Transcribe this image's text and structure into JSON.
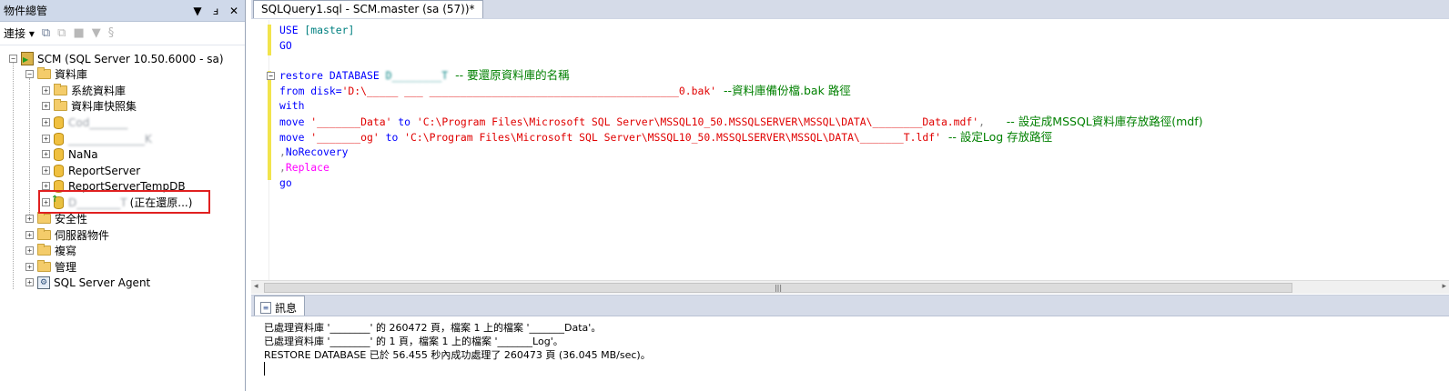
{
  "object_explorer": {
    "title": "物件總管",
    "pin_glyph": "▼ ‡",
    "close_glyph": "✕",
    "connect_label": "連接",
    "tree": {
      "server": "SCM (SQL Server 10.50.6000 - sa)",
      "databases": "資料庫",
      "system_databases": "系統資料庫",
      "db_snapshots": "資料庫快照集",
      "db1": "Cod_______",
      "db2": "______________K",
      "db3": "NaNa",
      "db4": "ReportServer",
      "db5": "ReportServerTempDB",
      "db6_name": "D________T",
      "db6_status": "(正在還原...)",
      "security": "安全性",
      "server_objects": "伺服器物件",
      "replication": "複寫",
      "management": "管理",
      "agent": "SQL Server Agent"
    }
  },
  "editor": {
    "tab_label": "SQLQuery1.sql - SCM.master (sa (57))*",
    "lines": {
      "l1_kw": "USE",
      "l1_rest": " [master]",
      "l2": "GO",
      "l4_kw": "restore DATABASE",
      "l4_db": " D________T",
      "l4_cmt": "  -- 要還原資料庫的名稱",
      "l5_kw": "from disk=",
      "l5_str": "'D:\\_____ ___ ________________________________________0.bak'",
      "l5_cmt": "  --資料庫備份檔.bak 路徑",
      "l6": "with",
      "l7_kw": "move",
      "l7_str1": " '_______Data'",
      "l7_to": " to",
      "l7_str2": " 'C:\\Program Files\\Microsoft SQL Server\\MSSQL10_50.MSSQLSERVER\\MSSQL\\DATA\\________Data.mdf'",
      "l7_comma": ",",
      "l7_cmt": "      -- 設定成MSSQL資料庫存放路徑(mdf)",
      "l8_kw": "move",
      "l8_str1": " '_______og'",
      "l8_to": " to",
      "l8_str2": " 'C:\\Program Files\\Microsoft SQL Server\\MSSQL10_50.MSSQLSERVER\\MSSQL\\DATA\\_______T.ldf'",
      "l8_cmt": "  -- 設定Log 存放路徑",
      "l9_comma": ",",
      "l9_kw": "NoRecovery",
      "l10_comma": ",",
      "l10_kw": "Replace",
      "l11": "go"
    }
  },
  "results": {
    "tab_label": "訊息",
    "messages": [
      "已處理資料庫 '________' 的 260472 頁，檔案 1 上的檔案 '_______Data'。",
      "已處理資料庫 '________' 的 1 頁，檔案 1 上的檔案 '_______Log'。",
      "RESTORE DATABASE 已於 56.455 秒內成功處理了 260473 頁 (36.045 MB/sec)。"
    ]
  }
}
